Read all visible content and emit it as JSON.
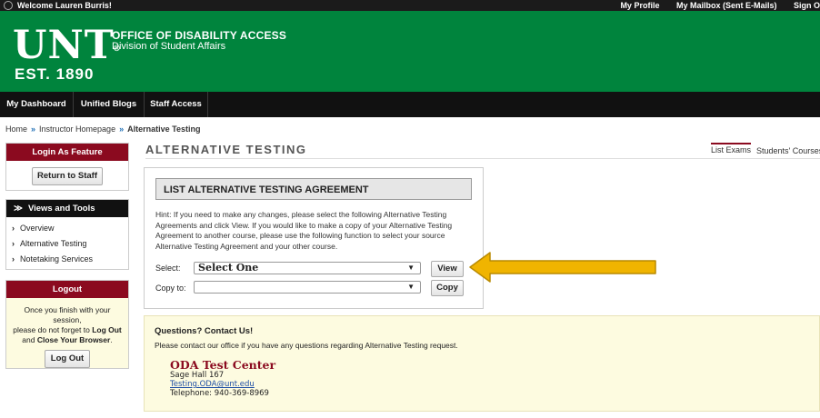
{
  "topbar": {
    "welcome": "Welcome Lauren Burris!",
    "links": [
      "My Profile",
      "My Mailbox (Sent E-Mails)",
      "Sign O"
    ]
  },
  "header": {
    "logo_text": "UNT",
    "logo_mark": "®",
    "est": "EST. 1890",
    "office": "OFFICE OF DISABILITY ACCESS",
    "division": "Division of Student Affairs"
  },
  "nav": [
    "My Dashboard",
    "Unified Blogs",
    "Staff Access"
  ],
  "breadcrumb": {
    "items": [
      "Home",
      "Instructor Homepage",
      "Alternative Testing"
    ],
    "separator": "»"
  },
  "sidebar": {
    "login_feature": {
      "title": "Login As Feature",
      "button": "Return to Staff"
    },
    "views": {
      "title": "Views and Tools",
      "items": [
        "Overview",
        "Alternative Testing",
        "Notetaking Services"
      ]
    },
    "logout": {
      "title": "Logout",
      "text_a": "Once you finish with your session,",
      "text_b": "please do not forget to",
      "text_b_bold": "Log Out",
      "text_c": "and",
      "text_c_bold": "Close Your Browser",
      "text_c_end": ".",
      "button": "Log Out"
    }
  },
  "main": {
    "title": "ALTERNATIVE TESTING",
    "tabs": [
      "List Exams",
      "Students' Courses"
    ],
    "form": {
      "heading": "LIST ALTERNATIVE TESTING AGREEMENT",
      "hint": "Hint: If you need to make any changes, please select the following Alternative Testing Agreements and click View. If you would like to make a copy of your Alternative Testing Agreement to another course, please use the following function to select your source Alternative Testing Agreement and your other course.",
      "select_label": "Select:",
      "select_value": "Select One",
      "view_button": "View",
      "copy_label": "Copy to:",
      "copy_value": "",
      "copy_button": "Copy"
    },
    "contact": {
      "title": "Questions? Contact Us!",
      "text": "Please contact our office if you have any questions regarding Alternative Testing request.",
      "center": "ODA Test Center",
      "address": "Sage Hall 167",
      "email": "Testing.ODA@unt.edu",
      "phone": "Telephone: 940-369-8969"
    }
  },
  "colors": {
    "green": "#00843d",
    "maroon": "#8b0a1f",
    "black": "#111111",
    "arrow": "#f0b400",
    "info_bg": "#fdfbe0"
  }
}
